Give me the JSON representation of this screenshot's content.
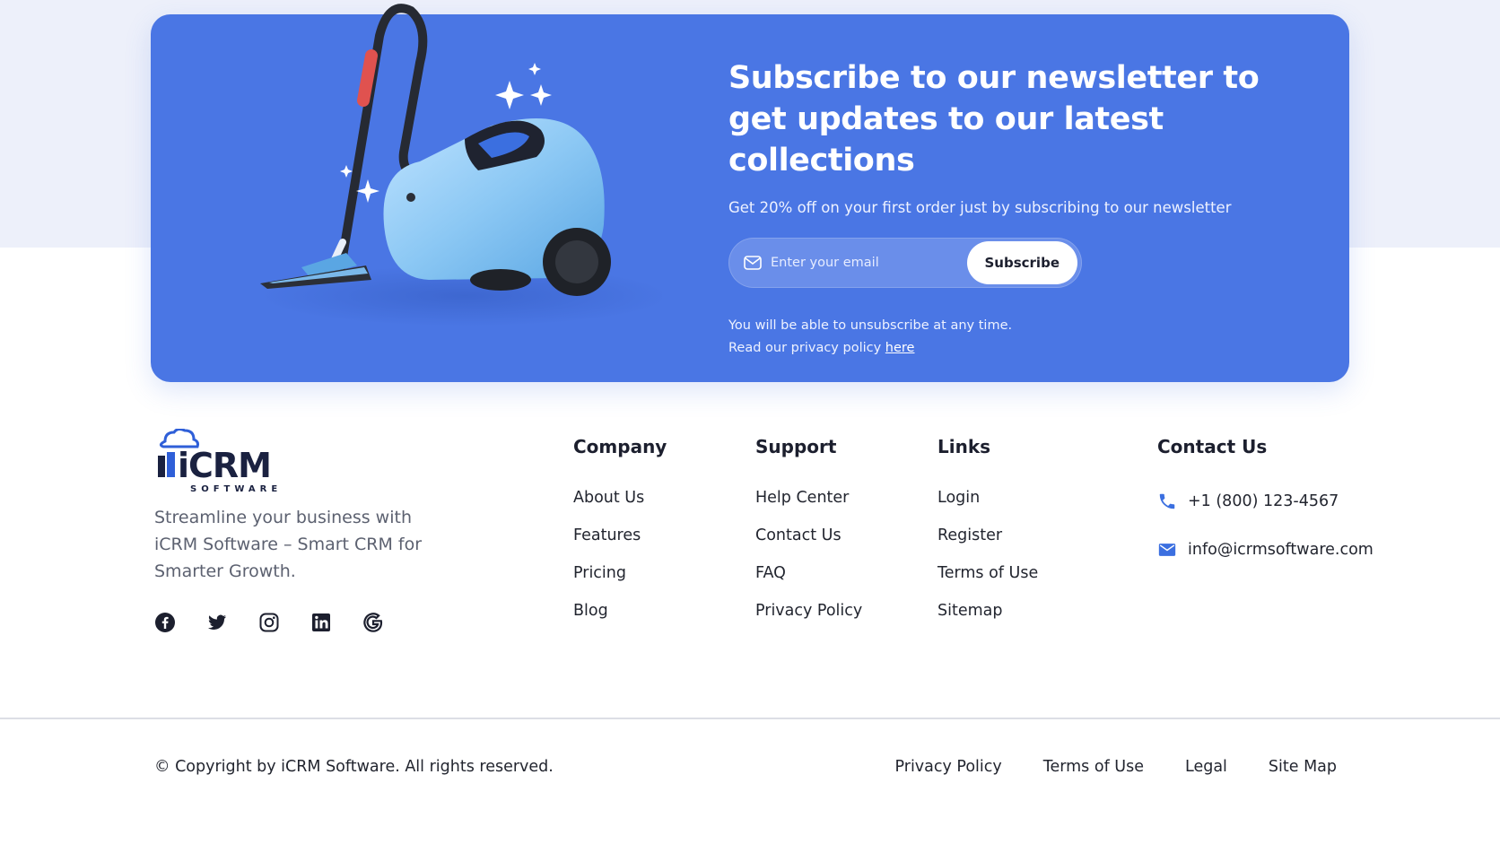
{
  "newsletter": {
    "title": "Subscribe to our newsletter to get updates to our latest collections",
    "subtitle": "Get 20% off on your first order just by subscribing to our newsletter",
    "email_placeholder": "Enter your email",
    "subscribe_label": "Subscribe",
    "note_line1": "You will be able to unsubscribe at any time.",
    "note_line2_prefix": "Read our privacy policy",
    "note_link": "here",
    "accent_color": "#4a76e4"
  },
  "brand": {
    "logo_text": "iCRM",
    "logo_subtext": "SOFTWARE",
    "tagline": "Streamline your business with iCRM Software – Smart CRM for Smarter Growth.",
    "logo_color": "#2f5fd8",
    "logo_dark": "#1a2140",
    "socials": [
      "facebook-icon",
      "twitter-icon",
      "instagram-icon",
      "linkedin-icon",
      "google-icon"
    ]
  },
  "columns": {
    "company": {
      "title": "Company",
      "items": [
        "About Us",
        "Features",
        "Pricing",
        "Blog"
      ]
    },
    "support": {
      "title": "Support",
      "items": [
        "Help Center",
        "Contact Us",
        "FAQ",
        "Privacy Policy"
      ]
    },
    "links": {
      "title": "Links",
      "items": [
        "Login",
        "Register",
        "Terms of Use",
        "Sitemap"
      ]
    }
  },
  "contact": {
    "title": "Contact Us",
    "phone": "+1 (800) 123-4567",
    "email": "info@icrmsoftware.com",
    "icon_color": "#3b6fe0"
  },
  "bottom": {
    "copyright": "© Copyright by iCRM Software. All rights reserved.",
    "links": [
      "Privacy Policy",
      "Terms of Use",
      "Legal",
      "Site Map"
    ]
  }
}
